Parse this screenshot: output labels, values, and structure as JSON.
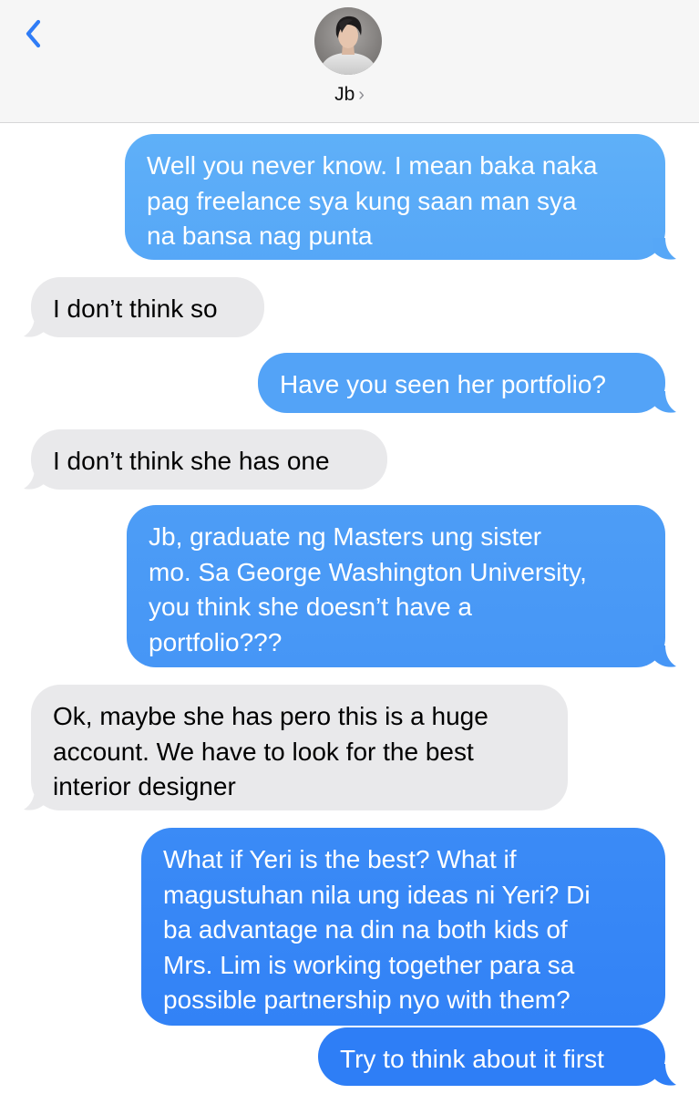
{
  "header": {
    "contact_name": "Jb",
    "chevron": "›",
    "avatar_icon": "contact-avatar-photo",
    "back_icon": "chevron-left-icon"
  },
  "colors": {
    "accent_blue": "#2f7cf6",
    "outgoing_top": "#5aaaf7",
    "outgoing_bottom": "#2d7ff6",
    "incoming_bg": "#e9e9eb",
    "header_bg": "#f6f6f6"
  },
  "messages": [
    {
      "direction": "outgoing",
      "lines": [
        "Well you never know. I mean baka naka",
        "pag freelance sya kung saan man sya",
        "na bansa nag punta"
      ]
    },
    {
      "direction": "incoming",
      "lines": [
        "I don’t think so"
      ]
    },
    {
      "direction": "outgoing",
      "lines": [
        "Have you seen her portfolio?"
      ]
    },
    {
      "direction": "incoming",
      "lines": [
        "I don’t think she has one"
      ]
    },
    {
      "direction": "outgoing",
      "lines": [
        "Jb, graduate ng Masters ung sister",
        "mo. Sa George Washington University,",
        "you think she doesn’t have a",
        "portfolio???"
      ]
    },
    {
      "direction": "incoming",
      "lines": [
        "Ok, maybe she has pero this is a huge",
        "account. We have to look for the best",
        "interior designer"
      ]
    },
    {
      "direction": "outgoing",
      "lines": [
        "What if Yeri is the best? What if",
        "magustuhan nila ung ideas ni Yeri? Di",
        "ba advantage na din na both kids of",
        "Mrs. Lim is working together para sa",
        "possible partnership nyo with them?"
      ]
    },
    {
      "direction": "outgoing",
      "lines": [
        "Try to think about it first"
      ]
    }
  ]
}
